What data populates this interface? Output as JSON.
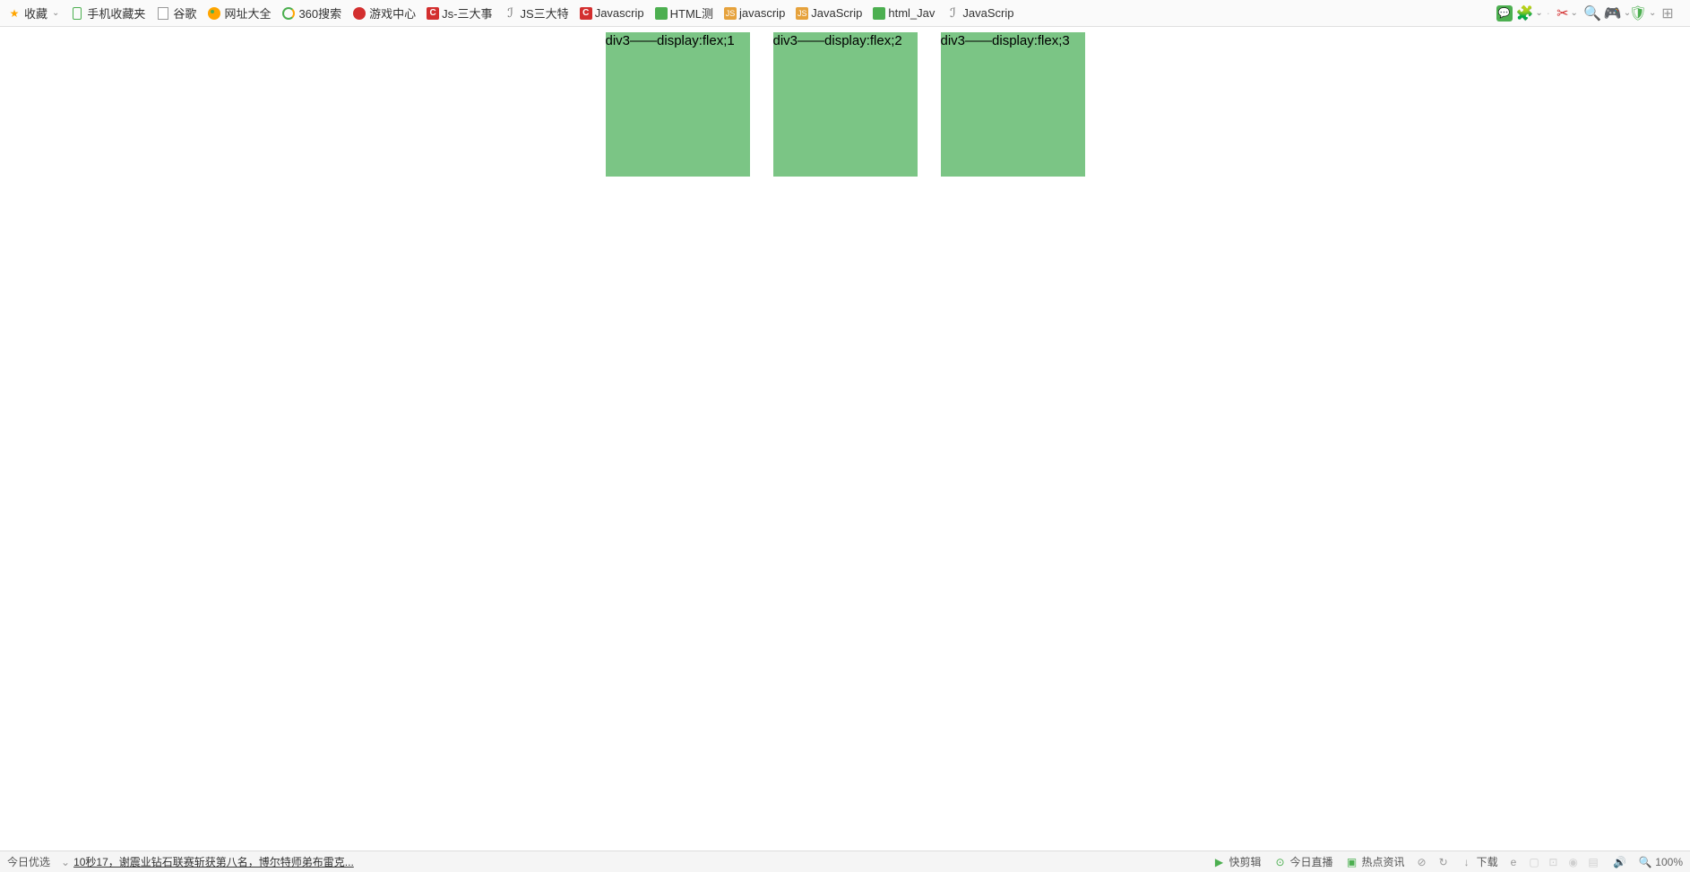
{
  "bookmarks": {
    "favorite": "收藏",
    "mobile_fav": "手机收藏夹",
    "google": "谷歌",
    "site_nav": "网址大全",
    "search_360": "360搜索",
    "game_center": "游戏中心",
    "js_three": "Js-三大事",
    "js_three_lite": "JS三大特",
    "javascript1": "Javascrip",
    "html_test": "HTML测",
    "javascript2": "javascrip",
    "javascript3": "JavaScrip",
    "html_jav": "html_Jav",
    "javascript4": "JavaScrip"
  },
  "content": {
    "boxes": [
      "div3——display:flex;1",
      "div3——display:flex;2",
      "div3——display:flex;3"
    ]
  },
  "statusbar": {
    "today_pick": "今日优选",
    "news_headline": "10秒17，谢震业钻石联赛斩获第八名，博尔特师弟布雷克...",
    "quick_clip": "快剪辑",
    "today_live": "今日直播",
    "hot_news": "热点资讯",
    "download": "下载",
    "zoom": "100%"
  }
}
